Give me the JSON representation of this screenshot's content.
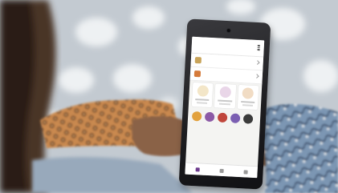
{
  "photo": {
    "description_icons": [
      "phone-icon",
      "hand-icon"
    ],
    "colors": {
      "background": "#c9d0d6",
      "spots": "#eef1f3",
      "wrap_orange": "#c9894f",
      "wrap_dark": "#5b3a26",
      "skin": "#8d6548",
      "blue_fabric": "#6f8fb0",
      "phone_body": "#1c1c1f",
      "accent": "#6e3c8e"
    }
  },
  "phone_app": {
    "title": "",
    "rows": [
      {
        "icon": "book-icon",
        "color": "#c9a45a"
      },
      {
        "icon": "coin-icon",
        "color": "#d57a3a"
      }
    ],
    "cards": [
      {
        "avatar": "person-icon"
      },
      {
        "avatar": "person-icon"
      },
      {
        "avatar": "person-icon"
      }
    ],
    "circles": [
      "#e2a13d",
      "#8c5aa6",
      "#c0463c",
      "#7b5fb2",
      "#3b3b3b"
    ]
  }
}
